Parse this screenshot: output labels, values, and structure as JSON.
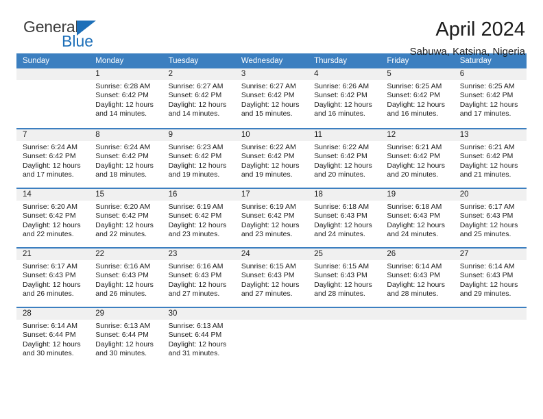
{
  "brand": {
    "name_part1": "General",
    "name_part2": "Blue",
    "triangle_color": "#1d6fb8"
  },
  "header": {
    "title": "April 2024",
    "subtitle": "Sabuwa, Katsina, Nigeria"
  },
  "theme": {
    "header_blue": "#3c7fc0",
    "daynum_band": "#f0f0f0",
    "text": "#1c1c1c"
  },
  "weekday_headers": [
    "Sunday",
    "Monday",
    "Tuesday",
    "Wednesday",
    "Thursday",
    "Friday",
    "Saturday"
  ],
  "labels": {
    "sunrise_prefix": "Sunrise: ",
    "sunset_prefix": "Sunset: ",
    "daylight_prefix": "Daylight: "
  },
  "weeks": [
    [
      {
        "day": "",
        "empty": true
      },
      {
        "day": "1",
        "sunrise": "Sunrise: 6:28 AM",
        "sunset": "Sunset: 6:42 PM",
        "daylight1": "Daylight: 12 hours",
        "daylight2": "and 14 minutes."
      },
      {
        "day": "2",
        "sunrise": "Sunrise: 6:27 AM",
        "sunset": "Sunset: 6:42 PM",
        "daylight1": "Daylight: 12 hours",
        "daylight2": "and 14 minutes."
      },
      {
        "day": "3",
        "sunrise": "Sunrise: 6:27 AM",
        "sunset": "Sunset: 6:42 PM",
        "daylight1": "Daylight: 12 hours",
        "daylight2": "and 15 minutes."
      },
      {
        "day": "4",
        "sunrise": "Sunrise: 6:26 AM",
        "sunset": "Sunset: 6:42 PM",
        "daylight1": "Daylight: 12 hours",
        "daylight2": "and 16 minutes."
      },
      {
        "day": "5",
        "sunrise": "Sunrise: 6:25 AM",
        "sunset": "Sunset: 6:42 PM",
        "daylight1": "Daylight: 12 hours",
        "daylight2": "and 16 minutes."
      },
      {
        "day": "6",
        "sunrise": "Sunrise: 6:25 AM",
        "sunset": "Sunset: 6:42 PM",
        "daylight1": "Daylight: 12 hours",
        "daylight2": "and 17 minutes."
      }
    ],
    [
      {
        "day": "7",
        "sunrise": "Sunrise: 6:24 AM",
        "sunset": "Sunset: 6:42 PM",
        "daylight1": "Daylight: 12 hours",
        "daylight2": "and 17 minutes."
      },
      {
        "day": "8",
        "sunrise": "Sunrise: 6:24 AM",
        "sunset": "Sunset: 6:42 PM",
        "daylight1": "Daylight: 12 hours",
        "daylight2": "and 18 minutes."
      },
      {
        "day": "9",
        "sunrise": "Sunrise: 6:23 AM",
        "sunset": "Sunset: 6:42 PM",
        "daylight1": "Daylight: 12 hours",
        "daylight2": "and 19 minutes."
      },
      {
        "day": "10",
        "sunrise": "Sunrise: 6:22 AM",
        "sunset": "Sunset: 6:42 PM",
        "daylight1": "Daylight: 12 hours",
        "daylight2": "and 19 minutes."
      },
      {
        "day": "11",
        "sunrise": "Sunrise: 6:22 AM",
        "sunset": "Sunset: 6:42 PM",
        "daylight1": "Daylight: 12 hours",
        "daylight2": "and 20 minutes."
      },
      {
        "day": "12",
        "sunrise": "Sunrise: 6:21 AM",
        "sunset": "Sunset: 6:42 PM",
        "daylight1": "Daylight: 12 hours",
        "daylight2": "and 20 minutes."
      },
      {
        "day": "13",
        "sunrise": "Sunrise: 6:21 AM",
        "sunset": "Sunset: 6:42 PM",
        "daylight1": "Daylight: 12 hours",
        "daylight2": "and 21 minutes."
      }
    ],
    [
      {
        "day": "14",
        "sunrise": "Sunrise: 6:20 AM",
        "sunset": "Sunset: 6:42 PM",
        "daylight1": "Daylight: 12 hours",
        "daylight2": "and 22 minutes."
      },
      {
        "day": "15",
        "sunrise": "Sunrise: 6:20 AM",
        "sunset": "Sunset: 6:42 PM",
        "daylight1": "Daylight: 12 hours",
        "daylight2": "and 22 minutes."
      },
      {
        "day": "16",
        "sunrise": "Sunrise: 6:19 AM",
        "sunset": "Sunset: 6:42 PM",
        "daylight1": "Daylight: 12 hours",
        "daylight2": "and 23 minutes."
      },
      {
        "day": "17",
        "sunrise": "Sunrise: 6:19 AM",
        "sunset": "Sunset: 6:42 PM",
        "daylight1": "Daylight: 12 hours",
        "daylight2": "and 23 minutes."
      },
      {
        "day": "18",
        "sunrise": "Sunrise: 6:18 AM",
        "sunset": "Sunset: 6:43 PM",
        "daylight1": "Daylight: 12 hours",
        "daylight2": "and 24 minutes."
      },
      {
        "day": "19",
        "sunrise": "Sunrise: 6:18 AM",
        "sunset": "Sunset: 6:43 PM",
        "daylight1": "Daylight: 12 hours",
        "daylight2": "and 24 minutes."
      },
      {
        "day": "20",
        "sunrise": "Sunrise: 6:17 AM",
        "sunset": "Sunset: 6:43 PM",
        "daylight1": "Daylight: 12 hours",
        "daylight2": "and 25 minutes."
      }
    ],
    [
      {
        "day": "21",
        "sunrise": "Sunrise: 6:17 AM",
        "sunset": "Sunset: 6:43 PM",
        "daylight1": "Daylight: 12 hours",
        "daylight2": "and 26 minutes."
      },
      {
        "day": "22",
        "sunrise": "Sunrise: 6:16 AM",
        "sunset": "Sunset: 6:43 PM",
        "daylight1": "Daylight: 12 hours",
        "daylight2": "and 26 minutes."
      },
      {
        "day": "23",
        "sunrise": "Sunrise: 6:16 AM",
        "sunset": "Sunset: 6:43 PM",
        "daylight1": "Daylight: 12 hours",
        "daylight2": "and 27 minutes."
      },
      {
        "day": "24",
        "sunrise": "Sunrise: 6:15 AM",
        "sunset": "Sunset: 6:43 PM",
        "daylight1": "Daylight: 12 hours",
        "daylight2": "and 27 minutes."
      },
      {
        "day": "25",
        "sunrise": "Sunrise: 6:15 AM",
        "sunset": "Sunset: 6:43 PM",
        "daylight1": "Daylight: 12 hours",
        "daylight2": "and 28 minutes."
      },
      {
        "day": "26",
        "sunrise": "Sunrise: 6:14 AM",
        "sunset": "Sunset: 6:43 PM",
        "daylight1": "Daylight: 12 hours",
        "daylight2": "and 28 minutes."
      },
      {
        "day": "27",
        "sunrise": "Sunrise: 6:14 AM",
        "sunset": "Sunset: 6:43 PM",
        "daylight1": "Daylight: 12 hours",
        "daylight2": "and 29 minutes."
      }
    ],
    [
      {
        "day": "28",
        "sunrise": "Sunrise: 6:14 AM",
        "sunset": "Sunset: 6:44 PM",
        "daylight1": "Daylight: 12 hours",
        "daylight2": "and 30 minutes."
      },
      {
        "day": "29",
        "sunrise": "Sunrise: 6:13 AM",
        "sunset": "Sunset: 6:44 PM",
        "daylight1": "Daylight: 12 hours",
        "daylight2": "and 30 minutes."
      },
      {
        "day": "30",
        "sunrise": "Sunrise: 6:13 AM",
        "sunset": "Sunset: 6:44 PM",
        "daylight1": "Daylight: 12 hours",
        "daylight2": "and 31 minutes."
      },
      {
        "day": "",
        "empty": true
      },
      {
        "day": "",
        "empty": true
      },
      {
        "day": "",
        "empty": true
      },
      {
        "day": "",
        "empty": true
      }
    ]
  ]
}
